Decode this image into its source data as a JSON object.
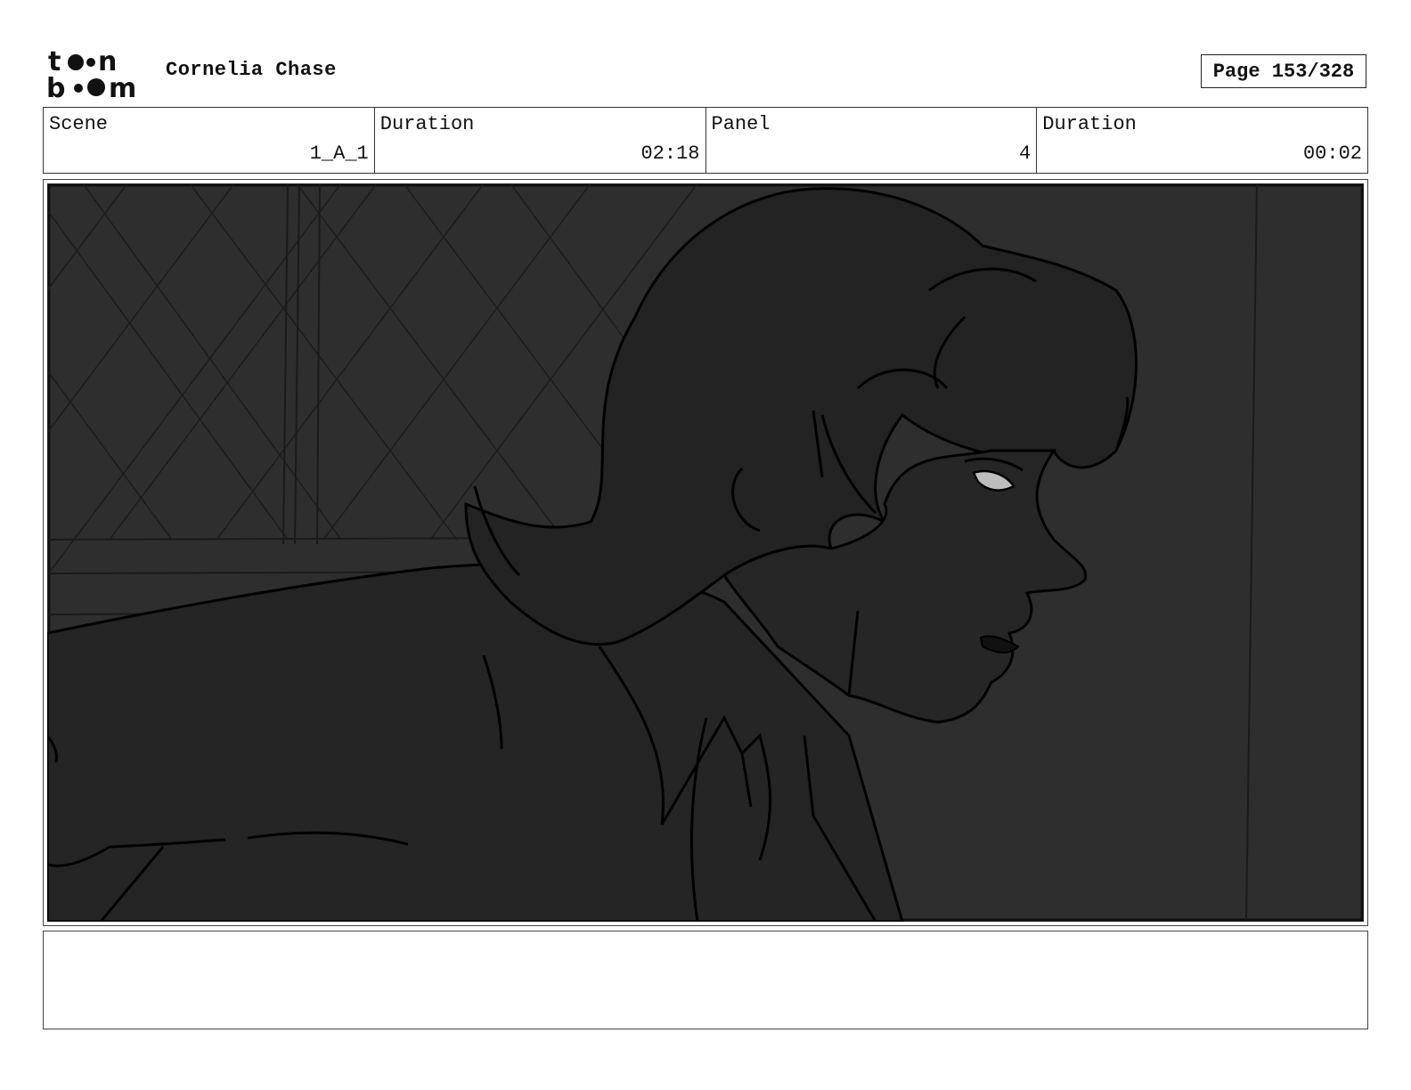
{
  "header": {
    "logo_name": "toonboom-logo",
    "project_title": "Cornelia Chase",
    "page_label": "Page 153/328"
  },
  "info": {
    "scene_label": "Scene",
    "scene_value": "1_A_1",
    "scene_duration_label": "Duration",
    "scene_duration_value": "02:18",
    "panel_label": "Panel",
    "panel_value": "4",
    "panel_duration_label": "Duration",
    "panel_duration_value": "00:02"
  },
  "notes": {
    "text": ""
  },
  "colors": {
    "panel_background": "#2b2b2b",
    "figure_fill": "#262626",
    "line_color": "#000000",
    "eye_highlight": "#bdbdbd"
  }
}
